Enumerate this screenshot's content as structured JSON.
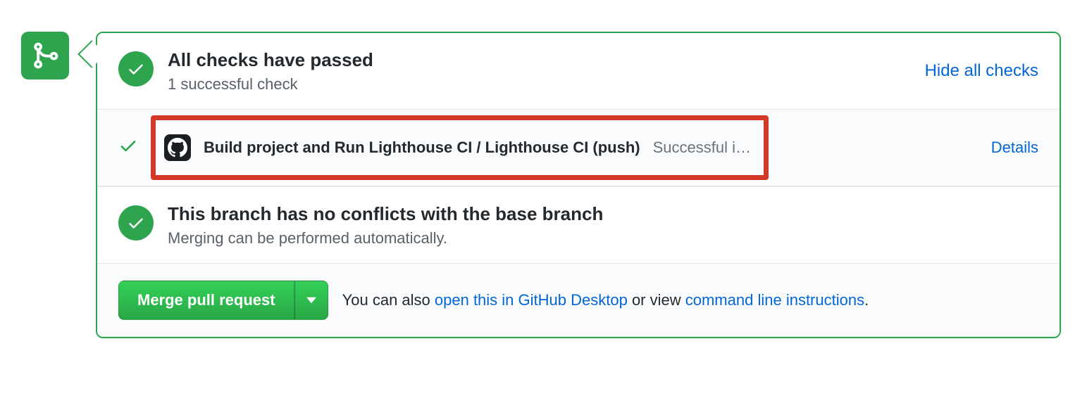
{
  "checks": {
    "heading": "All checks have passed",
    "subtext": "1 successful check",
    "toggle_label": "Hide all checks",
    "items": [
      {
        "name": "Build project and Run Lighthouse CI / Lighthouse CI (push)",
        "status": "Successful i…",
        "details_label": "Details"
      }
    ]
  },
  "conflicts": {
    "heading": "This branch has no conflicts with the base branch",
    "subtext": "Merging can be performed automatically."
  },
  "merge": {
    "button_label": "Merge pull request",
    "hint_prefix": "You can also ",
    "desktop_link": "open this in GitHub Desktop",
    "hint_middle": " or view ",
    "cli_link": "command line instructions",
    "hint_suffix": "."
  }
}
